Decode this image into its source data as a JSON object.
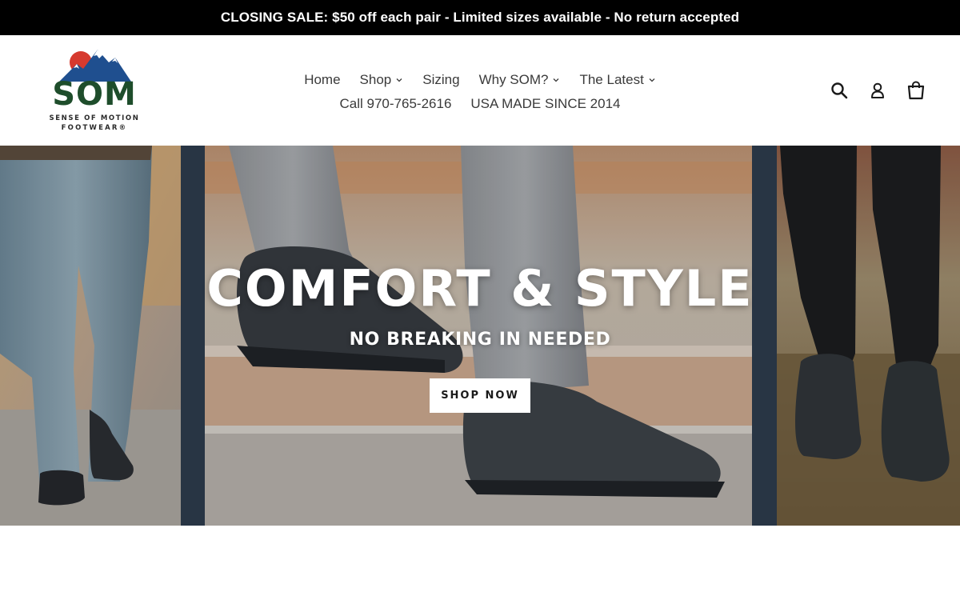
{
  "announcement": {
    "text": "CLOSING SALE: $50 off each pair - Limited sizes available - No return accepted"
  },
  "logo": {
    "wordmark": "SOM",
    "tagline_line1": "SENSE OF MOTION",
    "tagline_line2": "FOOTWEAR®"
  },
  "nav": {
    "items": [
      {
        "label": "Home",
        "has_dropdown": false
      },
      {
        "label": "Shop",
        "has_dropdown": true
      },
      {
        "label": "Sizing",
        "has_dropdown": false
      },
      {
        "label": "Why SOM?",
        "has_dropdown": true
      },
      {
        "label": "The Latest",
        "has_dropdown": true
      }
    ],
    "secondary": [
      {
        "label": "Call 970-765-2616"
      },
      {
        "label": "USA MADE SINCE 2014"
      }
    ]
  },
  "header_tools": {
    "icons": [
      "search-icon",
      "account-icon",
      "cart-icon"
    ]
  },
  "hero": {
    "title": "COMFORT & STYLE",
    "subtitle": "NO BREAKING IN NEEDED",
    "button_label": "SHOP NOW"
  },
  "colors": {
    "announcement_bg": "#000000",
    "brand_green": "#1e4d2b",
    "brand_blue": "#1f4f8f",
    "brand_red": "#d63a2f",
    "hero_divider": "#2c3a4a"
  }
}
